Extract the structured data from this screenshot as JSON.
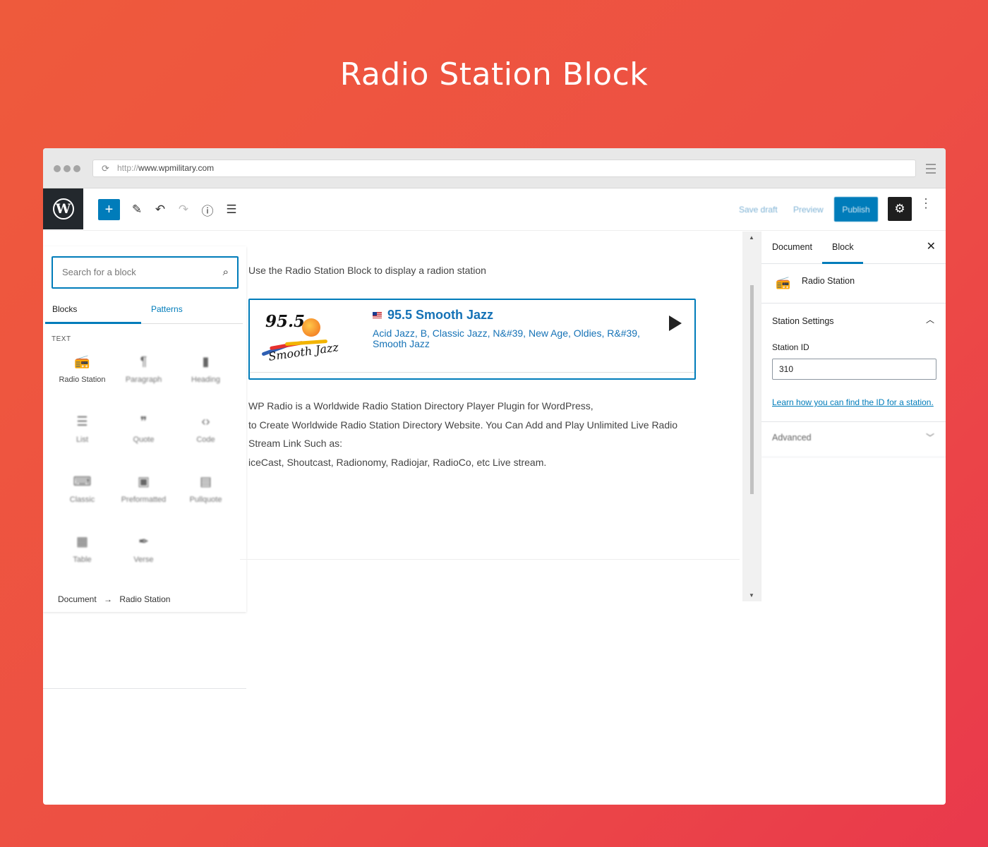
{
  "hero": {
    "title": "Radio Station Block"
  },
  "browser": {
    "url_protocol": "http://",
    "url_host": "www.wpmilitary.com"
  },
  "toolbar": {
    "icons": [
      "plus-icon",
      "pencil-icon",
      "undo-icon",
      "redo-icon",
      "info-icon",
      "list-view-icon"
    ],
    "save_draft": "Save draft",
    "preview": "Preview",
    "publish": "Publish",
    "accent_color": "#007cba"
  },
  "inserter": {
    "search_placeholder": "Search for a block",
    "tabs": [
      "Blocks",
      "Patterns"
    ],
    "category": "TEXT",
    "blocks": [
      {
        "label": "Radio Station",
        "icon": "radio-icon"
      },
      {
        "label": "Paragraph",
        "icon": "paragraph-icon"
      },
      {
        "label": "Heading",
        "icon": "bookmark-icon"
      },
      {
        "label": "List",
        "icon": "list-icon"
      },
      {
        "label": "Quote",
        "icon": "quote-icon"
      },
      {
        "label": "Code",
        "icon": "code-icon"
      },
      {
        "label": "Classic",
        "icon": "keyboard-icon"
      },
      {
        "label": "Preformatted",
        "icon": "preformatted-icon"
      },
      {
        "label": "Pullquote",
        "icon": "pullquote-icon"
      },
      {
        "label": "Table",
        "icon": "table-icon"
      },
      {
        "label": "Verse",
        "icon": "feather-icon"
      }
    ]
  },
  "breadcrumb": {
    "root": "Document",
    "separator": "→",
    "current": "Radio Station"
  },
  "editor": {
    "intro": "Use the Radio Station Block to display a radion station",
    "station": {
      "logo_number": "95.5",
      "logo_script": "Smooth Jazz",
      "name": "95.5 Smooth Jazz",
      "genres": "Acid Jazz, B, Classic Jazz, N&#39, New Age, Oldies, R&#39, Smooth Jazz"
    },
    "description": [
      "WP Radio is a Worldwide Radio Station Directory Player Plugin for WordPress,",
      "to Create Worldwide Radio Station Directory Website. You Can Add and Play Unlimited Live Radio",
      "Stream Link Such as:",
      "iceCast, Shoutcast, Radionomy, Radiojar, RadioCo, etc Live stream."
    ]
  },
  "sidebar": {
    "tabs": [
      "Document",
      "Block"
    ],
    "block_name": "Radio Station",
    "panel_title": "Station Settings",
    "field_label": "Station ID",
    "field_value": "310",
    "help_link": "Learn how you can find the ID for a station.",
    "advanced": "Advanced"
  }
}
